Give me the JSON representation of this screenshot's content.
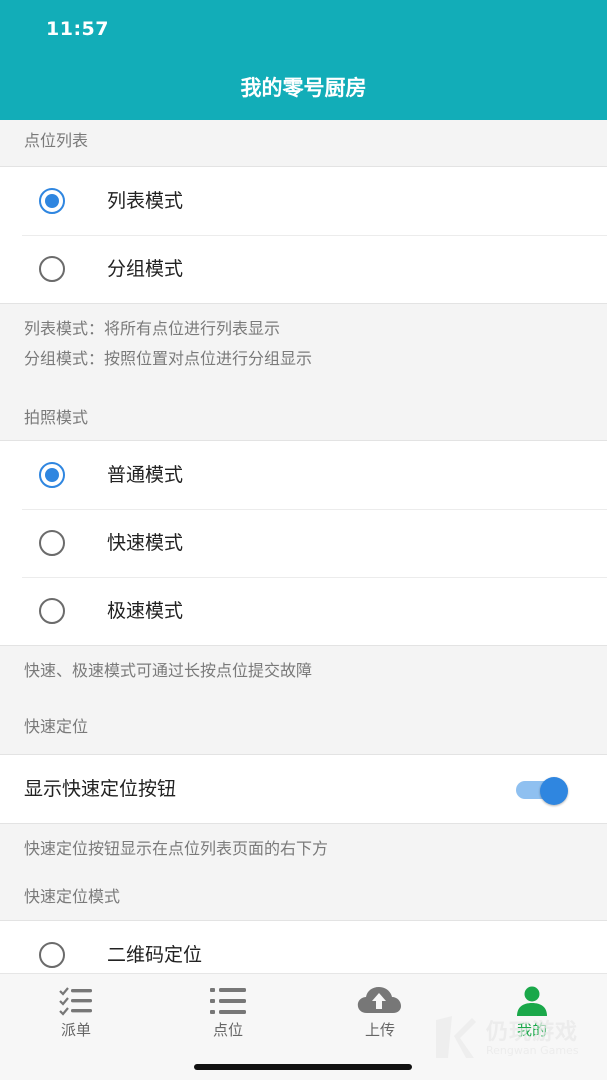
{
  "status_bar": {
    "time": "11:57"
  },
  "header": {
    "title": "我的零号厨房"
  },
  "point_list": {
    "section_label": "点位列表",
    "options": [
      {
        "label": "列表模式",
        "selected": true
      },
      {
        "label": "分组模式",
        "selected": false
      }
    ],
    "notes": [
      "列表模式：将所有点位进行列表显示",
      "分组模式：按照位置对点位进行分组显示"
    ]
  },
  "photo_mode": {
    "section_label": "拍照模式",
    "options": [
      {
        "label": "普通模式",
        "selected": true
      },
      {
        "label": "快速模式",
        "selected": false
      },
      {
        "label": "极速模式",
        "selected": false
      }
    ],
    "note": "快速、极速模式可通过长按点位提交故障"
  },
  "quick_locate": {
    "section_label": "快速定位",
    "switch_label": "显示快速定位按钮",
    "switch_on": true,
    "note": "快速定位按钮显示在点位列表页面的右下方"
  },
  "quick_locate_mode": {
    "section_label": "快速定位模式",
    "options": [
      {
        "label": "二维码定位",
        "selected": false
      }
    ]
  },
  "tabbar": {
    "tabs": [
      {
        "label": "派单",
        "icon": "checklist-icon",
        "active": false
      },
      {
        "label": "点位",
        "icon": "list-icon",
        "active": false
      },
      {
        "label": "上传",
        "icon": "cloud-upload-icon",
        "active": false
      },
      {
        "label": "我的",
        "icon": "person-icon",
        "active": true
      }
    ]
  },
  "watermark": {
    "text": "仍玩游戏",
    "sub": "Rengwan Games"
  },
  "colors": {
    "header": "#12adb8",
    "accent": "#2f86e0",
    "active_tab": "#1aa84a"
  }
}
